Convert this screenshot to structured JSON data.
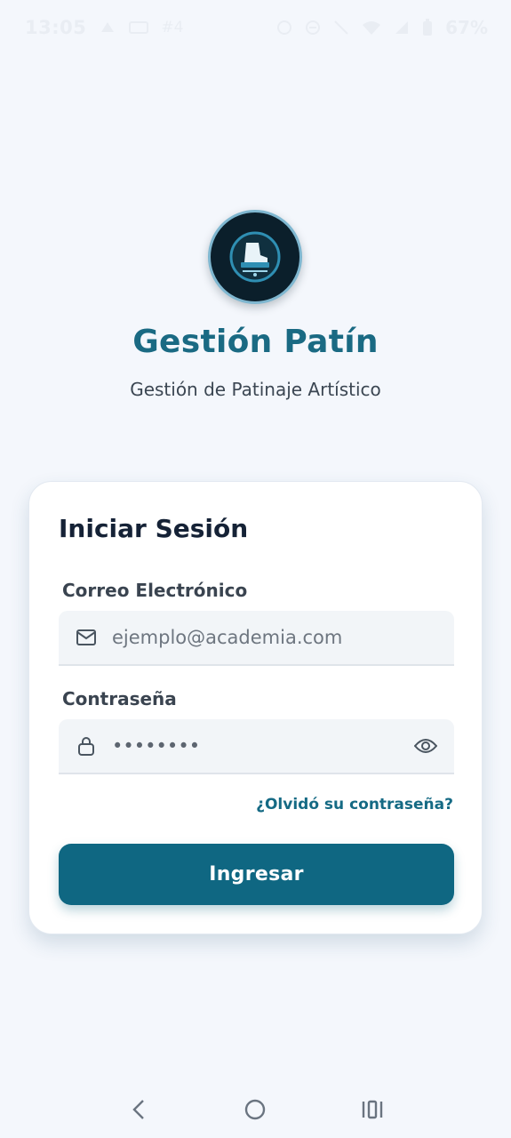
{
  "status_bar": {
    "time": "13:05",
    "extra": "#4",
    "battery": "67%"
  },
  "header": {
    "title": "Gestión Patín",
    "subtitle": "Gestión de Patinaje Artístico"
  },
  "login_card": {
    "title": "Iniciar Sesión",
    "email": {
      "label": "Correo Electrónico",
      "placeholder": "ejemplo@academia.com",
      "value": ""
    },
    "password": {
      "label": "Contraseña",
      "value": "••••••••"
    },
    "forgot_link": "¿Olvidó su contraseña?",
    "submit_label": "Ingresar"
  },
  "icons": {
    "email": "mail-icon",
    "password": "lock-icon",
    "toggle": "eye-icon"
  },
  "colors": {
    "primary": "#0f6782",
    "title": "#1a6a83",
    "background": "#f4f7fc"
  }
}
